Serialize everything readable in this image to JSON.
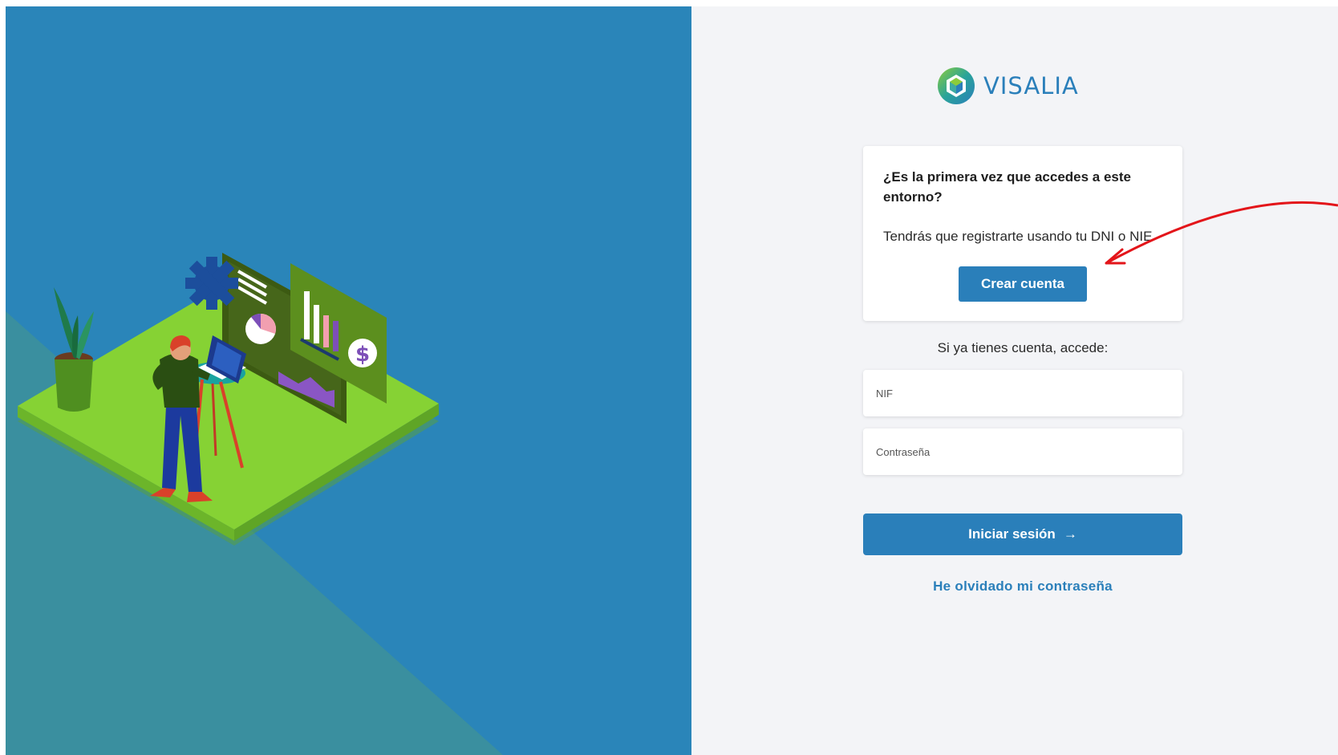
{
  "brand": {
    "name": "VISALIA",
    "color": "#2a7fba"
  },
  "first_access_card": {
    "title": "¿Es la primera vez que accedes a este entorno?",
    "text": "Tendrás que registrarte usando tu DNI o NIE",
    "create_button_label": "Crear cuenta"
  },
  "login": {
    "prompt": "Si ya tienes cuenta, accede:",
    "nif_placeholder": "NIF",
    "nif_value": "",
    "password_placeholder": "Contraseña",
    "password_value": "",
    "submit_label": "Iniciar sesión",
    "submit_icon": "arrow-right-icon",
    "forgot_password_label": "He olvidado mi contraseña"
  },
  "colors": {
    "left_panel": "#2a85b9",
    "right_panel": "#f3f4f7",
    "accent": "#2a7fba",
    "annotation_arrow": "#e3151a"
  }
}
